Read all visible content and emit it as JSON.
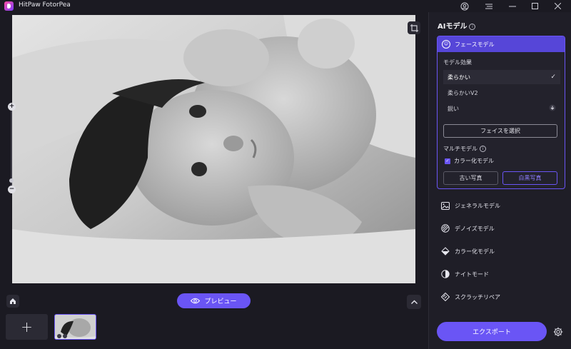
{
  "app": {
    "title": "HitPaw FotorPea"
  },
  "panel": {
    "title": "AIモデル",
    "face_model": {
      "label": "フェースモデル",
      "effect_label": "モデル効果",
      "options": [
        "柔らかい",
        "柔らかいV2",
        "鋭い"
      ],
      "selected": "柔らかい",
      "select_face_button": "フェイスを選択",
      "multi_model_label": "マルチモデル",
      "colorize_checkbox": "カラー化モデル",
      "colorize_checked": true,
      "old_photo_button": "古い写真",
      "bw_photo_button": "白黒写真"
    },
    "models": [
      {
        "label": "ジェネラルモデル",
        "icon": "image-icon"
      },
      {
        "label": "デノイズモデル",
        "icon": "denoise-icon"
      },
      {
        "label": "カラー化モデル",
        "icon": "paint-bucket-icon"
      },
      {
        "label": "ナイトモード",
        "icon": "half-circle-icon"
      },
      {
        "label": "スクラッチリペア",
        "icon": "scratch-icon"
      }
    ],
    "export_button": "エクスポート"
  },
  "bottom": {
    "preview_button": "プレビュー"
  },
  "colors": {
    "accent": "#6a55f5",
    "background": "#1b1a22",
    "panel": "#1f1e27"
  }
}
